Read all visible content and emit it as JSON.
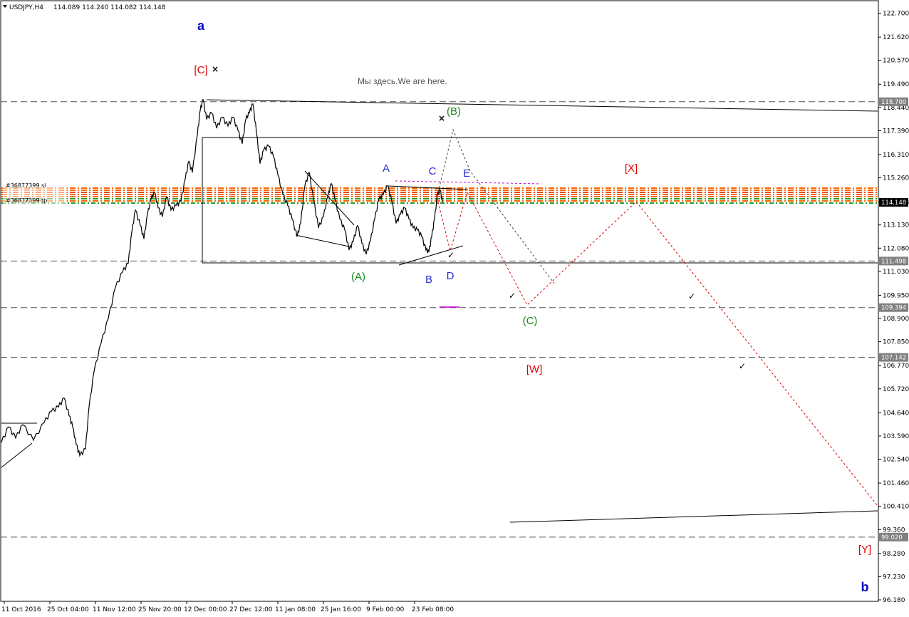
{
  "header": {
    "symbol": "USDJPY,H4",
    "ohlc": "114.089 114.240 114.082 114.148"
  },
  "note": "Мы здесь.We are here.",
  "chart_data": {
    "type": "candlestick",
    "symbol": "USDJPY",
    "timeframe": "H4",
    "ylim": [
      96.18,
      122.75
    ],
    "y_ticks": [
      "122.700",
      "121.620",
      "120.570",
      "119.490",
      "118.440",
      "117.390",
      "116.310",
      "115.260",
      "114.148",
      "113.130",
      "112.080",
      "111.030",
      "109.950",
      "108.900",
      "107.850",
      "106.770",
      "105.720",
      "104.640",
      "103.590",
      "102.540",
      "101.460",
      "100.410",
      "99.360",
      "98.280",
      "97.230",
      "96.180"
    ],
    "x_ticks": [
      "11 Oct 2016",
      "25 Oct 04:00",
      "11 Nov 12:00",
      "25 Nov 20:00",
      "12 Dec 00:00",
      "27 Dec 12:00",
      "11 Jan 08:00",
      "25 Jan 16:00",
      "9 Feb 00:00",
      "23 Feb 08:00"
    ],
    "current_price": 114.148,
    "price_path": [
      [
        0,
        103.3
      ],
      [
        10,
        104.0
      ],
      [
        20,
        103.5
      ],
      [
        30,
        104.1
      ],
      [
        45,
        103.4
      ],
      [
        60,
        104.2
      ],
      [
        70,
        104.7
      ],
      [
        80,
        104.9
      ],
      [
        88,
        105.3
      ],
      [
        95,
        104.5
      ],
      [
        100,
        104.0
      ],
      [
        105,
        103.2
      ],
      [
        110,
        102.7
      ],
      [
        118,
        103.0
      ],
      [
        123,
        104.9
      ],
      [
        130,
        106.5
      ],
      [
        140,
        107.8
      ],
      [
        150,
        108.9
      ],
      [
        160,
        110.3
      ],
      [
        170,
        111.0
      ],
      [
        178,
        111.4
      ],
      [
        183,
        112.8
      ],
      [
        188,
        113.8
      ],
      [
        195,
        113.1
      ],
      [
        200,
        112.5
      ],
      [
        205,
        113.6
      ],
      [
        210,
        114.3
      ],
      [
        215,
        114.6
      ],
      [
        220,
        113.9
      ],
      [
        226,
        113.5
      ],
      [
        232,
        114.4
      ],
      [
        238,
        113.8
      ],
      [
        245,
        114.0
      ],
      [
        252,
        114.2
      ],
      [
        258,
        115.2
      ],
      [
        263,
        116.0
      ],
      [
        268,
        115.5
      ],
      [
        275,
        117.2
      ],
      [
        279,
        118.3
      ],
      [
        283,
        118.8
      ],
      [
        288,
        117.9
      ],
      [
        295,
        118.2
      ],
      [
        302,
        117.5
      ],
      [
        310,
        118.0
      ],
      [
        318,
        117.6
      ],
      [
        325,
        118.0
      ],
      [
        332,
        117.4
      ],
      [
        338,
        116.8
      ],
      [
        343,
        117.9
      ],
      [
        348,
        118.2
      ],
      [
        353,
        118.6
      ],
      [
        358,
        117.3
      ],
      [
        363,
        115.9
      ],
      [
        368,
        116.5
      ],
      [
        375,
        116.7
      ],
      [
        382,
        116.2
      ],
      [
        388,
        115.4
      ],
      [
        395,
        114.5
      ],
      [
        402,
        114.0
      ],
      [
        408,
        113.4
      ],
      [
        415,
        112.6
      ],
      [
        420,
        113.2
      ],
      [
        426,
        114.9
      ],
      [
        432,
        115.5
      ],
      [
        438,
        114.3
      ],
      [
        445,
        113.0
      ],
      [
        452,
        113.5
      ],
      [
        458,
        114.4
      ],
      [
        463,
        115.0
      ],
      [
        468,
        114.3
      ],
      [
        475,
        113.4
      ],
      [
        482,
        112.9
      ],
      [
        488,
        112.0
      ],
      [
        494,
        112.4
      ],
      [
        500,
        113.1
      ],
      [
        506,
        112.3
      ],
      [
        512,
        111.8
      ],
      [
        518,
        112.4
      ],
      [
        524,
        113.4
      ],
      [
        530,
        114.3
      ],
      [
        536,
        114.5
      ],
      [
        542,
        114.9
      ],
      [
        548,
        114.2
      ],
      [
        554,
        113.2
      ],
      [
        560,
        113.6
      ],
      [
        566,
        113.9
      ],
      [
        572,
        113.4
      ],
      [
        578,
        113.0
      ],
      [
        584,
        112.9
      ],
      [
        590,
        112.6
      ],
      [
        596,
        112.0
      ],
      [
        600,
        111.9
      ],
      [
        604,
        112.6
      ],
      [
        608,
        113.4
      ],
      [
        612,
        114.5
      ],
      [
        616,
        114.7
      ],
      [
        619,
        114.15
      ]
    ],
    "horizontal_levels": [
      {
        "price": 118.7,
        "label": "118.700"
      },
      {
        "price": 111.498,
        "label": "111.498"
      },
      {
        "price": 109.394,
        "label": "109.394"
      },
      {
        "price": 107.142,
        "label": "107.142"
      },
      {
        "price": 99.02,
        "label": "99.020"
      }
    ],
    "order_lines": [
      "#36877399 sl",
      "#36877399 tp"
    ],
    "wave_labels": [
      {
        "text": "a",
        "color": "#0000cc"
      },
      {
        "text": "[C]",
        "color": "#e00000"
      },
      {
        "text": "(B)",
        "color": "#1a8a1a"
      },
      {
        "text": "A",
        "color": "#2a2ad0"
      },
      {
        "text": "C",
        "color": "#2a2ad0"
      },
      {
        "text": "E",
        "color": "#2a2ad0"
      },
      {
        "text": "[X]",
        "color": "#e00000"
      },
      {
        "text": "(A)",
        "color": "#1a8a1a"
      },
      {
        "text": "B",
        "color": "#2a2ad0"
      },
      {
        "text": "D",
        "color": "#2a2ad0"
      },
      {
        "text": "(C)",
        "color": "#1a8a1a"
      },
      {
        "text": "[W]",
        "color": "#e00000"
      },
      {
        "text": "[Y]",
        "color": "#e00000"
      },
      {
        "text": "b",
        "color": "#0000cc"
      }
    ]
  }
}
